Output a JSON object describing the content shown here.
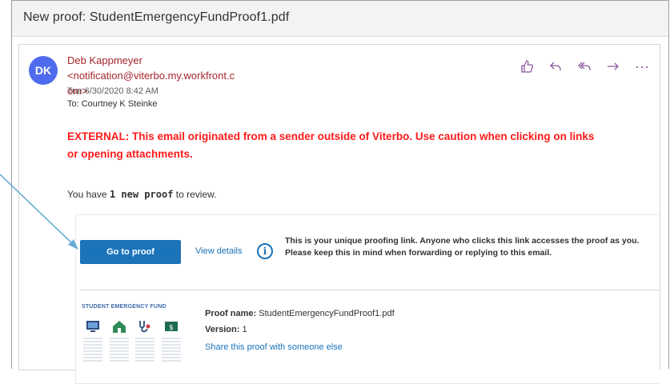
{
  "email": {
    "subject": "New proof: StudentEmergencyFundProof1.pdf",
    "avatar_initials": "DK",
    "sender_line1": "Deb Kappmeyer <notification@viterbo.my.workfront.c",
    "sender_line2": "om>",
    "date": "Tue 6/30/2020 8:42 AM",
    "to": "To:  Courtney K Steinke",
    "warning": "EXTERNAL: This email originated from a sender outside of Viterbo. Use caution when clicking on links or opening attachments.",
    "intro_pre": "You have ",
    "intro_bold": "1 new proof",
    "intro_post": " to review."
  },
  "actions": {
    "like_icon": "thumbs-up-icon",
    "reply_icon": "reply-icon",
    "reply_all_icon": "reply-all-icon",
    "forward_icon": "forward-icon",
    "more_icon": "more-icon"
  },
  "proof": {
    "go_button": "Go to proof",
    "view_details": "View details",
    "info_text": "This is your unique proofing link. Anyone who clicks this link accesses the proof as you. Please keep this in mind when forwarding or replying to this email.",
    "thumbnail_title": "STUDENT EMERGENCY FUND",
    "name_label": "Proof name:",
    "name_value": "StudentEmergencyFundProof1.pdf",
    "version_label": "Version:",
    "version_value": "1",
    "share_link": "Share this proof with someone else"
  },
  "colors": {
    "accent": "#1b73b9",
    "warning": "#ff1a1a",
    "avatar": "#4f6bed",
    "arrow": "#6aaed6"
  }
}
